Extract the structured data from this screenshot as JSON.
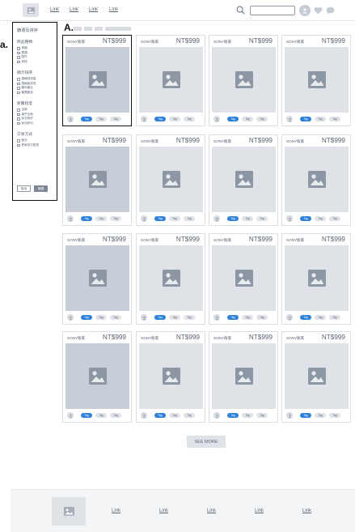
{
  "header": {
    "nav_links": [
      "Link",
      "Link",
      "Link",
      "Link"
    ]
  },
  "annotations": {
    "filter_label": "a.",
    "card_label": "A."
  },
  "filter": {
    "title": "篩選及排序",
    "groups": [
      {
        "title": "商品種類",
        "options": [
          "相機",
          "鏡頭",
          "配件",
          "其他"
        ]
      },
      {
        "title": "顯示排序",
        "options": [
          "價格低到高",
          "價格高到低",
          "離你最近",
          "最受歡迎"
        ]
      },
      {
        "title": "新舊程度",
        "options": [
          "全新",
          "幾乎全新",
          "狀況良好",
          "狀況尚可"
        ]
      },
      {
        "title": "交易方式",
        "options": [
          "面交",
          "賣家自行配送"
        ]
      }
    ],
    "cancel_label": "取消",
    "apply_label": "篩選"
  },
  "product": {
    "brand": "SONY販家",
    "price": "NT$999",
    "tags": [
      "Tag",
      "Tag",
      "Tag"
    ]
  },
  "see_more_label": "SEE MORE",
  "footer": {
    "links": [
      "Link",
      "Link",
      "Link",
      "Link",
      "Link"
    ]
  },
  "colors": {
    "accent": "#2f82d9",
    "placeholder": "#dfe3e8",
    "placeholder_dark": "#c7ced7",
    "text": "#5a6472"
  }
}
